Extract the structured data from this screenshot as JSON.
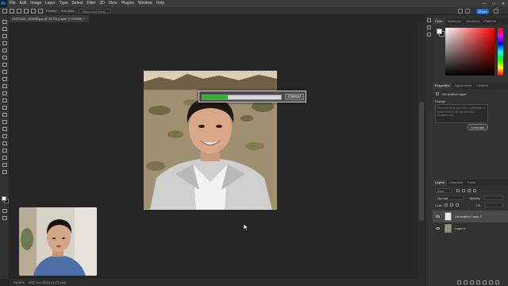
{
  "menubar": {
    "logo": "Ps",
    "items": [
      "File",
      "Edit",
      "Image",
      "Layer",
      "Type",
      "Select",
      "Filter",
      "3D",
      "View",
      "Plugins",
      "Window",
      "Help"
    ],
    "window_controls": [
      "—",
      "□",
      "✕"
    ]
  },
  "optionsbar": {
    "anti_alias": "Anti-alias",
    "feather_label": "Feather:",
    "select_subject": "Select and Mask...",
    "share_label": "Share"
  },
  "document": {
    "tab_title": "20221109_163838.jpg @ 33.3% (Layer 0, RGB/8) *",
    "progress": 0.32,
    "cancel_label": "Cancel"
  },
  "statusbar": {
    "zoom": "33.33%",
    "info": "4032 px x 3024 px (72 ppi)"
  },
  "panels": {
    "color_tabs": [
      "Color",
      "Swatches",
      "Gradients",
      "Patterns"
    ],
    "properties_tabs": [
      "Properties",
      "Adjustments",
      "Libraries"
    ],
    "generative_layer": "Generative Layer",
    "prompt_label": "Prompt",
    "prompt_placeholder": "Describe what you'd like to generate or leave blank to fill the selection. (English only)",
    "generate_label": "Generate",
    "layers_tabs": [
      "Layers",
      "Channels",
      "Paths"
    ],
    "kind_label": "Kind",
    "blend_mode": "Normal",
    "opacity_label": "Opacity:",
    "fill_label": "Fill:",
    "lock_label": "Lock:",
    "layers": [
      {
        "name": "Generative Layer 1",
        "selected": true
      },
      {
        "name": "Layer 0",
        "selected": false
      }
    ]
  },
  "colors": {
    "accent": "#1473e6",
    "progress_fill": "#33b033",
    "workspace": "#262626",
    "panel": "#323232"
  }
}
